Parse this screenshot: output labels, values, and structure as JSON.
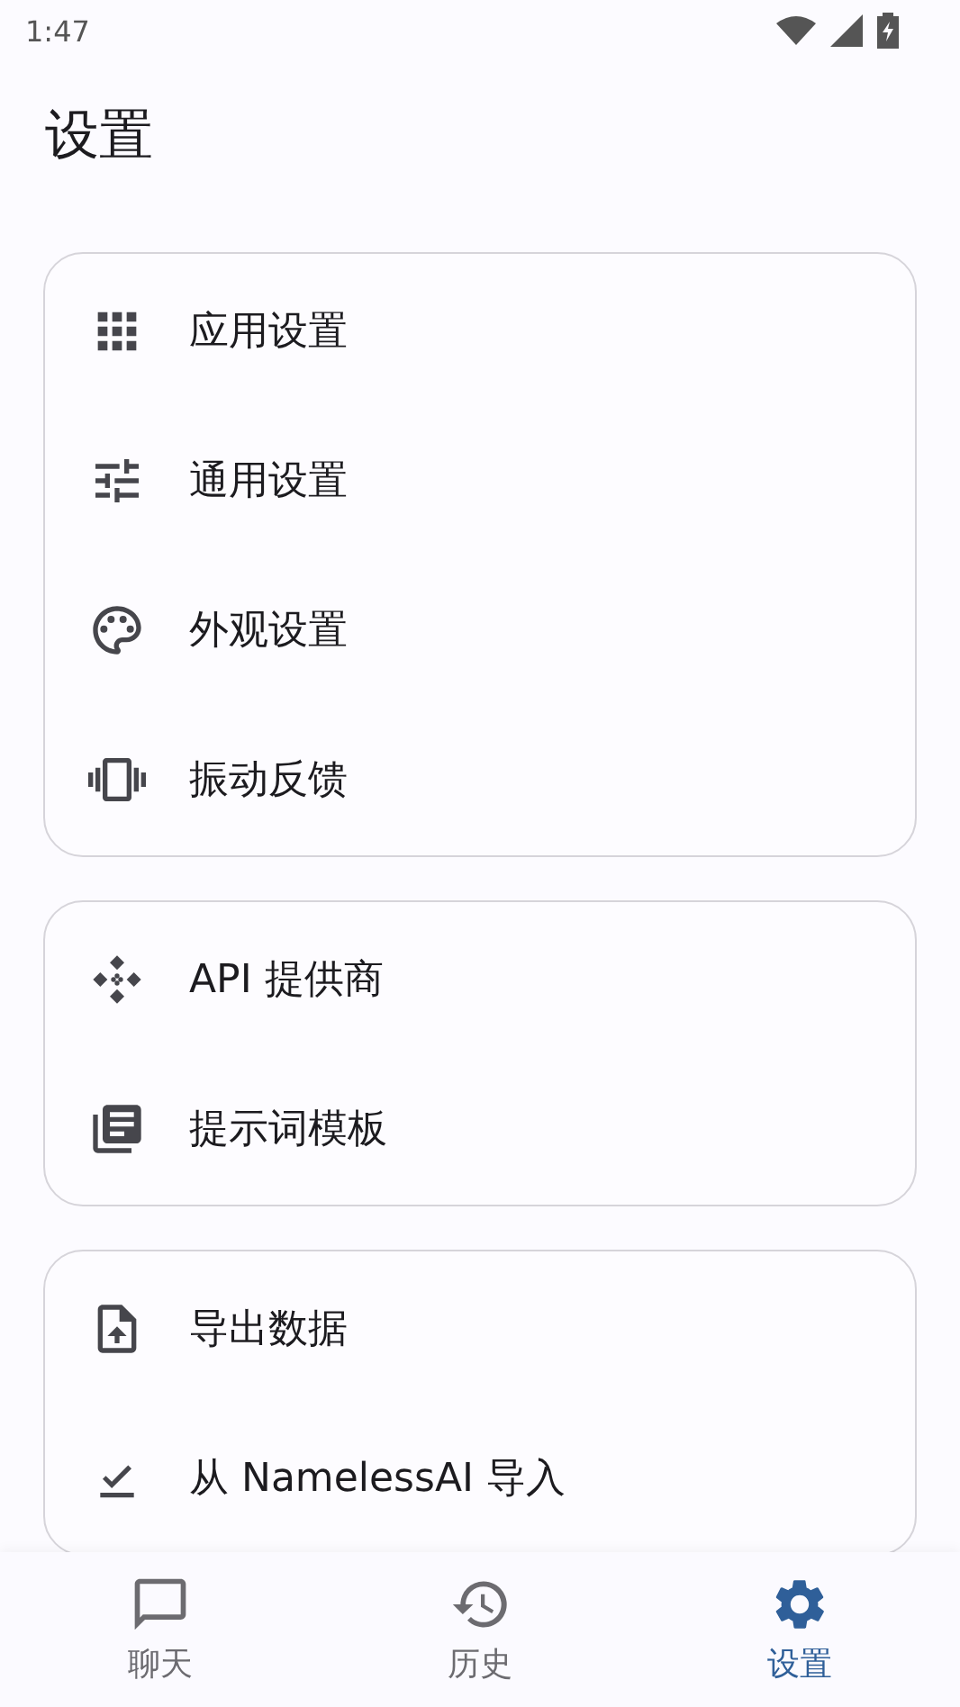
{
  "status_bar": {
    "time": "1:47"
  },
  "title": "设置",
  "groups": [
    {
      "items": [
        {
          "label": "应用设置"
        },
        {
          "label": "通用设置"
        },
        {
          "label": "外观设置"
        },
        {
          "label": "振动反馈"
        }
      ]
    },
    {
      "items": [
        {
          "label": "API 提供商"
        },
        {
          "label": "提示词模板"
        }
      ]
    },
    {
      "items": [
        {
          "label": "导出数据"
        },
        {
          "label": "从 NamelessAI 导入"
        }
      ]
    }
  ],
  "nav": [
    {
      "label": "聊天",
      "selected": false
    },
    {
      "label": "历史",
      "selected": false
    },
    {
      "label": "设置",
      "selected": true
    }
  ]
}
